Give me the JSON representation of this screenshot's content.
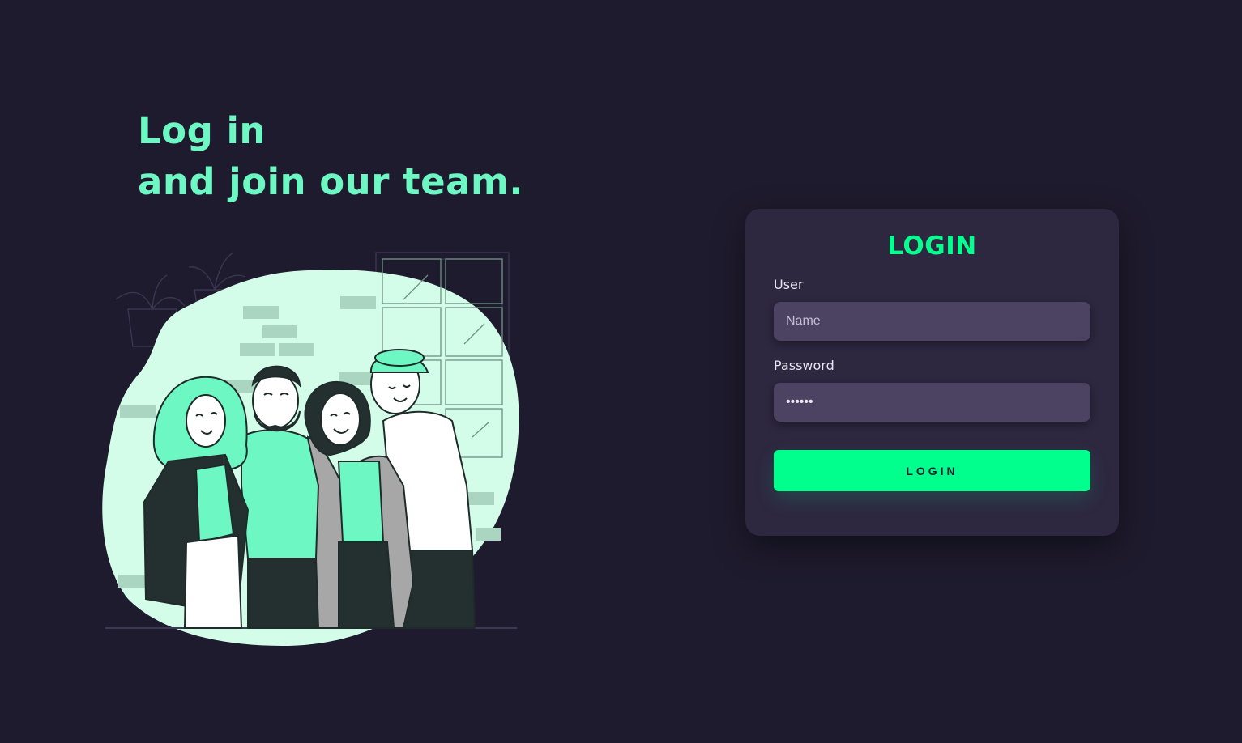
{
  "hero": {
    "line1": "Log in",
    "line2": "and join our team."
  },
  "login_card": {
    "title": "LOGIN",
    "user_label": "User",
    "user_placeholder": "Name",
    "password_label": "Password",
    "password_value": "••••••",
    "button_label": "LOGIN"
  },
  "colors": {
    "background": "#1f1b2e",
    "card": "#2d273f",
    "input": "#4c4362",
    "accent": "#00ff8c",
    "headline": "#6cf7c3",
    "blob": "#d3fde9"
  },
  "illustration": {
    "icon": "team-people-illustration"
  }
}
